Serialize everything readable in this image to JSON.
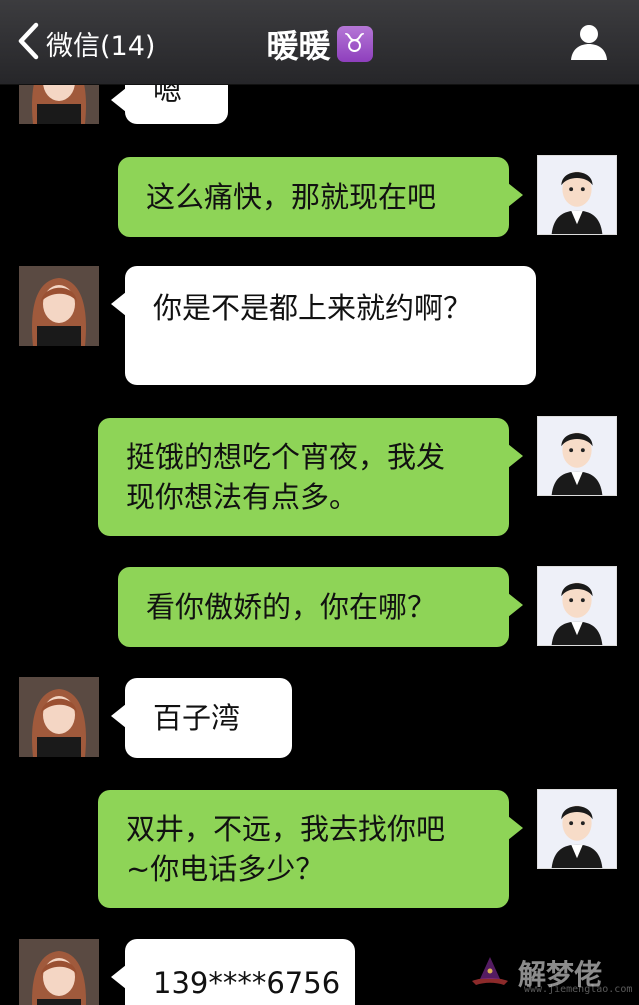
{
  "navbar": {
    "back_label": "微信(14)",
    "title": "暖暖",
    "zodiac_glyph": "♉",
    "zodiac_icon": "taurus-badge-icon",
    "profile_icon": "person-icon"
  },
  "messages": [
    {
      "from": "contact",
      "text": "嗯"
    },
    {
      "from": "me",
      "text": "这么痛快，那就现在吧"
    },
    {
      "from": "contact",
      "text": "你是不是都上来就约啊？"
    },
    {
      "from": "me",
      "lines": [
        "挺饿的想吃个宵夜，我发",
        "现你想法有点多。"
      ]
    },
    {
      "from": "me",
      "text": "看你傲娇的，你在哪？"
    },
    {
      "from": "contact",
      "text": "百子湾"
    },
    {
      "from": "me",
      "lines": [
        "双井，不远，我去找你吧",
        "~你电话多少？"
      ]
    },
    {
      "from": "contact",
      "text": "139****6756"
    }
  ],
  "watermark": {
    "text": "解梦佬",
    "url": "www.jiemenglao.com"
  }
}
